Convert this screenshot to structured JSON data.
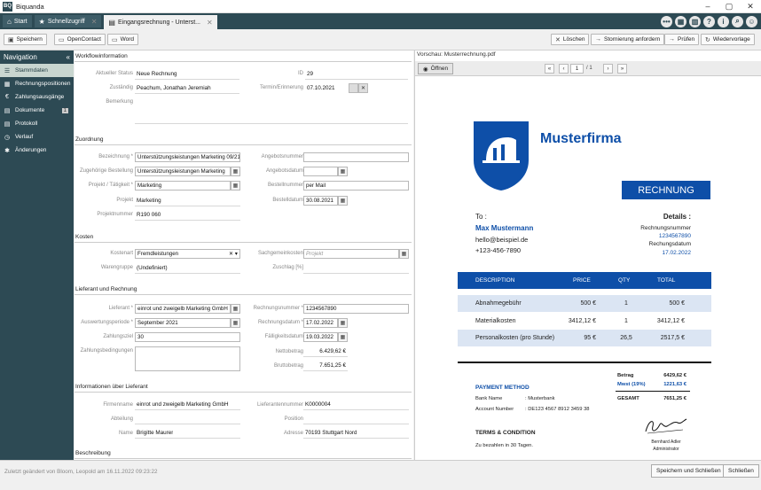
{
  "app": {
    "title": "Biquanda",
    "logo_text": "BQ"
  },
  "tabs": [
    {
      "label": "Start"
    },
    {
      "label": "Schnellzugriff"
    },
    {
      "label": "Eingangsrechnung - Unterst..."
    }
  ],
  "toolbar": {
    "save": "Speichern",
    "opencontact": "OpenContact",
    "word": "Word",
    "delete": "Löschen",
    "storno": "Stornierung anfordern",
    "check": "Prüfen",
    "resubmit": "Wiedervorlage"
  },
  "nav": {
    "title": "Navigation",
    "items": [
      {
        "label": "Stammdaten",
        "icon": "list-icon"
      },
      {
        "label": "Rechnungspositionen",
        "icon": "table-icon"
      },
      {
        "label": "Zahlungsausgänge",
        "icon": "euro-icon"
      },
      {
        "label": "Dokumente",
        "icon": "document-icon",
        "badge": "1"
      },
      {
        "label": "Protokoll",
        "icon": "protocol-icon"
      },
      {
        "label": "Verlauf",
        "icon": "history-icon"
      },
      {
        "label": "Änderungen",
        "icon": "changes-icon"
      }
    ]
  },
  "form": {
    "workflow": {
      "title": "Workflowinformation",
      "status_label": "Aktueller Status",
      "status": "Neue Rechnung",
      "responsible_label": "Zuständig",
      "responsible": "Peachum, Jonathan Jeremiah",
      "remark_label": "Bemerkung",
      "id_label": "ID",
      "id": "29",
      "due_label": "Termin/Erinnerung",
      "due": "07.10.2021"
    },
    "assignment": {
      "title": "Zuordnung",
      "designation_label": "Bezeichnung *",
      "designation": "Unterstützungsleistungen Marketing 09/21",
      "order_label": "Zugehörige Bestellung",
      "order": "Unterstützungsleistungen Marketing",
      "project_label": "Projekt / Tätigkeit *",
      "project": "Marketing",
      "project2_label": "Projekt",
      "project2": "Marketing",
      "projectno_label": "Projektnummer",
      "projectno": "R190 060",
      "offerno_label": "Angebotsnummer",
      "offerno": "",
      "offerdate_label": "Angebotsdatum",
      "offerdate": "",
      "orderno_label": "Bestellnummer",
      "orderno": "per Mail",
      "orderdate_label": "Bestelldatum",
      "orderdate": "30.08.2021"
    },
    "costs": {
      "title": "Kosten",
      "type_label": "Kostenart",
      "type": "Fremdleistungen",
      "group_label": "Warengruppe",
      "group": "(Undefiniert)",
      "account_label": "Sachgemeinkosten",
      "account_placeholder": "Projekt",
      "surcharge_label": "Zuschlag [%]",
      "surcharge": ""
    },
    "supplier": {
      "title": "Lieferant und Rechnung",
      "supplier_label": "Lieferant *",
      "supplier": "einrot und zweigelb Marketing GmbH",
      "period_label": "Auswertungsperiode *",
      "period": "September 2021",
      "terms_label": "Zahlungsziel",
      "terms": "30",
      "conditions_label": "Zahlungsbedingungen",
      "invoiceno_label": "Rechnungsnummer *",
      "invoiceno": "1234567890",
      "invoicedate_label": "Rechnungsdatum *",
      "invoicedate": "17.02.2022",
      "duedate_label": "Fälligkeitsdatum",
      "duedate": "19.03.2022",
      "net_label": "Nettobetrag",
      "net": "6.429,62 €",
      "gross_label": "Bruttobetrag",
      "gross": "7.651,25 €"
    },
    "supplierinfo": {
      "title": "Informationen über Lieferant",
      "company_label": "Firmenname",
      "company": "einrot und zweigelb Marketing GmbH",
      "dept_label": "Abteilung",
      "dept": "",
      "name_label": "Name",
      "name": "Brigitte Maurer",
      "supplierno_label": "Lieferantennummer",
      "supplierno": "K0000004",
      "position_label": "Position",
      "position": "",
      "address_label": "Adresse",
      "address": "70193 Stuttgart Nord"
    },
    "description": {
      "title": "Beschreibung"
    }
  },
  "preview": {
    "title": "Vorschau: Musterrechnung.pdf",
    "open": "Öffnen",
    "page": "1",
    "pageof": "/ 1",
    "doc": {
      "company": "Musterfirma",
      "heading": "RECHNUNG",
      "to_label": "To :",
      "to_name": "Max Mustermann",
      "to_email": "hello@beispiel.de",
      "to_phone": "+123-456-7890",
      "details_label": "Details :",
      "invoiceno_label": "Rechnungsnummer",
      "invoiceno": "1234567890",
      "date_label": "Rechungsdatum",
      "date": "17.02.2022",
      "cols": [
        "DESCRIPTION",
        "PRICE",
        "QTY",
        "TOTAL"
      ],
      "rows": [
        {
          "desc": "Abnahmegebühr",
          "price": "500 €",
          "qty": "1",
          "total": "500 €"
        },
        {
          "desc": "Materialkosten",
          "price": "3412,12 €",
          "qty": "1",
          "total": "3412,12 €"
        },
        {
          "desc": "Personalkosten (pro Stunde)",
          "price": "95 €",
          "qty": "26,5",
          "total": "2517,5 €"
        }
      ],
      "payment_title": "PAYMENT METHOD",
      "bank_label": "Bank Name",
      "bank": ": Musterbank",
      "account_label": "Account Number",
      "account": ": DE123 4567 8912 3459 38",
      "betrag_label": "Betrag",
      "betrag": "6429,62 €",
      "mwst_label": "Mwst (19%)",
      "mwst": "1221,63 €",
      "gesamt_label": "GESAMT",
      "gesamt": "7651,25 €",
      "terms_title": "TERMS & CONDITION",
      "terms_text": "Zu bezahlen in 30 Tagen.",
      "signer": "Bernhard Adler",
      "signer_role": "Administrator"
    }
  },
  "status": {
    "text": "Zuletzt geändert von Bloom, Leopold am 16.11.2022 09:23:22",
    "save_close": "Speichern und Schließen",
    "close": "Schließen"
  },
  "colors": {
    "nav": "#2d4a54",
    "brand": "#0e4fa8",
    "active_nav": "#c9d6d0"
  }
}
